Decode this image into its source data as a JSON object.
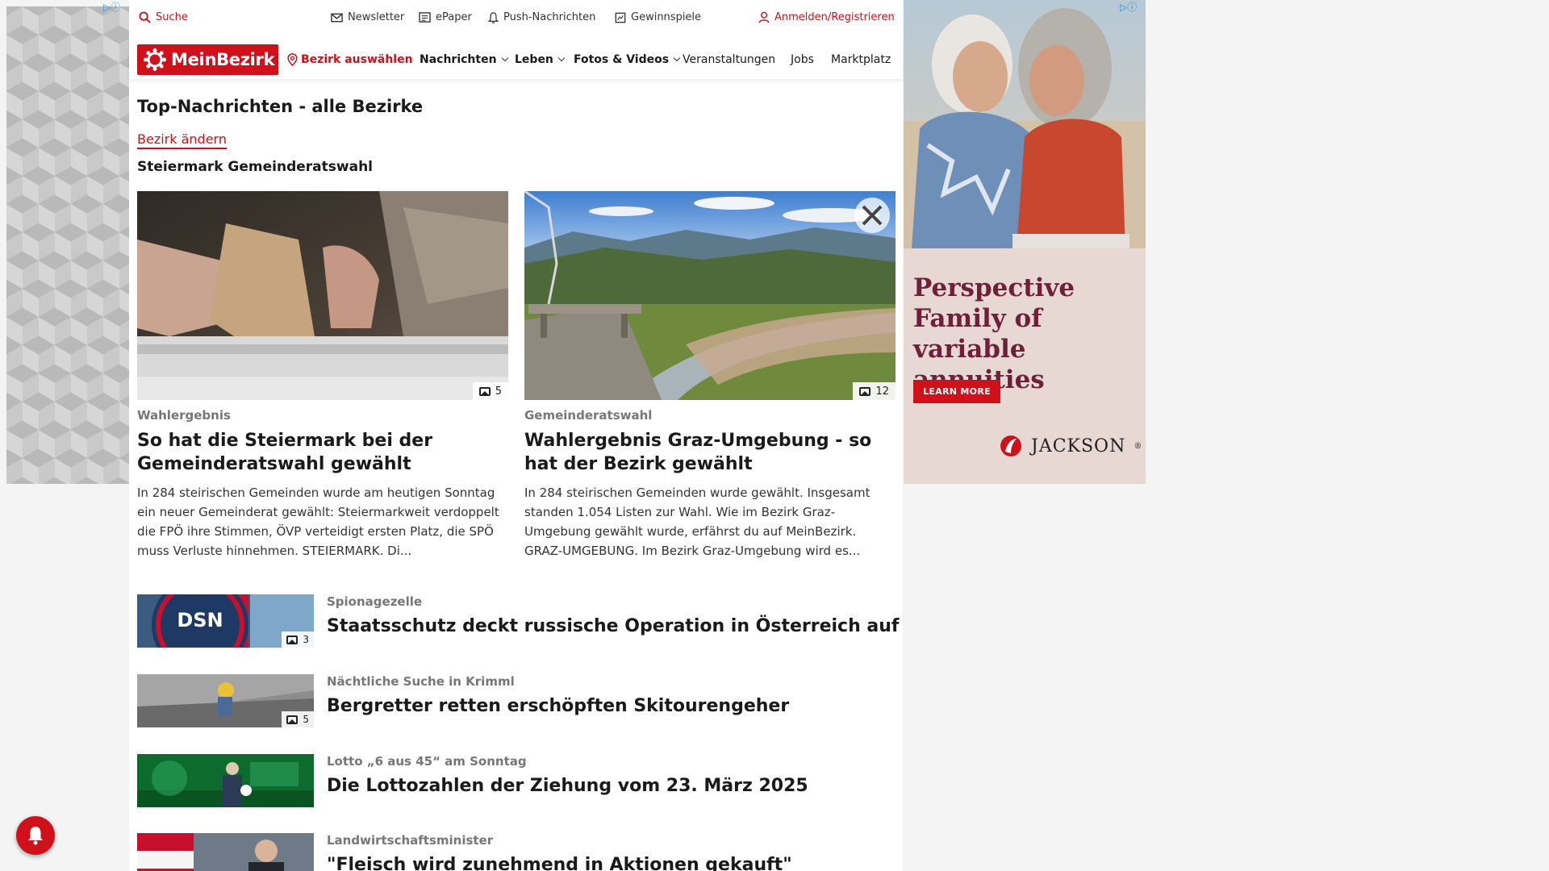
{
  "topbar": {
    "search": "Suche",
    "newsletter": "Newsletter",
    "epaper": "ePaper",
    "push": "Push-Nachrichten",
    "contests": "Gewinnspiele",
    "login": "Anmelden/Registrieren"
  },
  "nav": {
    "logo": "MeinBezirk",
    "select_district": "Bezirk auswählen",
    "items": [
      "Nachrichten",
      "Leben",
      "Fotos & Videos",
      "Veranstaltungen",
      "Jobs",
      "Marktplatz"
    ]
  },
  "page": {
    "title": "Top-Nachrichten - alle Bezirke",
    "change_district": "Bezirk ändern",
    "section": "Steiermark Gemeinderatswahl"
  },
  "cards": [
    {
      "kicker": "Wahlergebnis",
      "headline": "So hat die Steiermark bei der Gemeinderatswahl gewählt",
      "teaser": "In 284 steirischen Gemeinden wurde am heutigen Sonntag ein neuer Gemeinderat gewählt: Steiermarkweit verdoppelt die FPÖ ihre Stimmen, ÖVP verteidigt ersten Platz, die SPÖ muss Verluste hinnehmen.  STEIERMARK. Di...",
      "photos": "5"
    },
    {
      "kicker": "Gemeinderatswahl",
      "headline": "Wahlergebnis Graz-Umgebung - so hat der Bezirk gewählt",
      "teaser": "In 284 steirischen Gemeinden wurde gewählt. Insgesamt standen 1.054 Listen zur Wahl. Wie im Bezirk Graz-Umgebung gewählt wurde, erfährst du auf MeinBezirk. GRAZ-UMGEBUNG. Im Bezirk Graz-Umgebung wird es...",
      "photos": "12"
    }
  ],
  "list": [
    {
      "kicker": "Spionagezelle",
      "headline": "Staatsschutz deckt russische Operation in Österreich auf",
      "photos": "3",
      "thumb_text": "DSN"
    },
    {
      "kicker": "Nächtliche Suche in Krimml",
      "headline": "Bergretter retten erschöpften Skitourengeher",
      "photos": "5"
    },
    {
      "kicker": "Lotto „6 aus 45“ am Sonntag",
      "headline": "Die Lottozahlen der Ziehung vom 23. März 2025"
    },
    {
      "kicker": "Landwirtschaftsminister",
      "headline": "\"Fleisch wird zunehmend in Aktionen gekauft\""
    }
  ],
  "ad": {
    "headline": "Perspective Family of variable annuities",
    "button": "LEARN MORE",
    "brand": "JACKSON",
    "brand_mark": "®"
  },
  "colors": {
    "brand_red": "#d0111b",
    "ad_text": "#6e1f3a"
  }
}
